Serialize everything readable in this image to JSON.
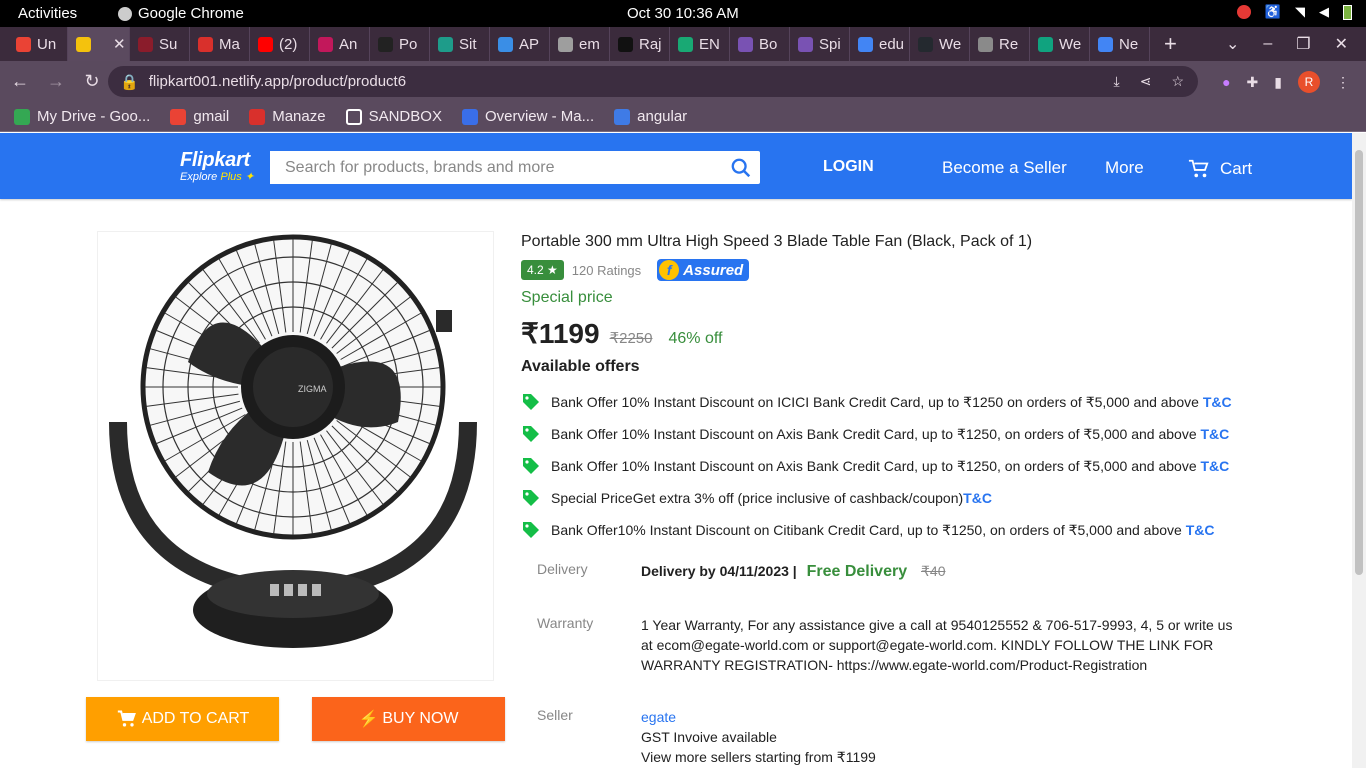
{
  "system": {
    "activities": "Activities",
    "app_name": "Google Chrome",
    "clock": "Oct 30  10:36 AM"
  },
  "tabs": [
    {
      "label": "Un",
      "color": "#ea4335"
    },
    {
      "label": "",
      "color": "#f4c20d"
    },
    {
      "label": "Su",
      "color": "#8a1c2b"
    },
    {
      "label": "Ma",
      "color": "#d9302c"
    },
    {
      "label": "(2)",
      "color": "#ff0000"
    },
    {
      "label": "An",
      "color": "#c2185b"
    },
    {
      "label": "Po",
      "color": "#222222"
    },
    {
      "label": "Sit",
      "color": "#1e9c8a"
    },
    {
      "label": "AP",
      "color": "#3a8ee6"
    },
    {
      "label": "em",
      "color": "#9e9e9e"
    },
    {
      "label": "Raj",
      "color": "#111111"
    },
    {
      "label": "EN",
      "color": "#19a974"
    },
    {
      "label": "Bo",
      "color": "#7952b3"
    },
    {
      "label": "Spi",
      "color": "#7952b3"
    },
    {
      "label": "edu",
      "color": "#4285f4"
    },
    {
      "label": "We",
      "color": "#24292f"
    },
    {
      "label": "Re",
      "color": "#8a8a8a"
    },
    {
      "label": "We",
      "color": "#10a37f"
    },
    {
      "label": "Ne",
      "color": "#4285f4"
    }
  ],
  "address": {
    "url": "flipkart001.netlify.app/product/product6"
  },
  "bookmarks": [
    {
      "label": "My Drive - Goo...",
      "color": "#34a853"
    },
    {
      "label": "gmail",
      "color": "#ea4335"
    },
    {
      "label": "Manaze",
      "color": "#d9302c"
    },
    {
      "label": "SANDBOX",
      "color": "#ffffff"
    },
    {
      "label": "Overview - Ma...",
      "color": "#3a6ee8"
    },
    {
      "label": "angular",
      "color": "#3f7be6"
    }
  ],
  "header": {
    "logo": "Flipkart",
    "logo_sub": "Explore",
    "logo_plus": "Plus",
    "search_placeholder": "Search for products, brands and more",
    "login": "LOGIN",
    "become_seller": "Become a Seller",
    "more": "More",
    "cart": "Cart",
    "brand_color": "#2874f0"
  },
  "product": {
    "title": "Portable 300 mm Ultra High Speed 3 Blade Table Fan (Black, Pack of 1)",
    "rating": "4.2 ★",
    "ratings_count": "120 Ratings",
    "assured": "Assured",
    "special": "Special price",
    "price": "₹1199",
    "mrp": "₹2250",
    "discount": "46% off",
    "available_offers": "Available offers",
    "offers": [
      {
        "text": "Bank Offer 10% Instant Discount on ICICI Bank Credit Card, up to ₹1250 on orders of ₹5,000 and above ",
        "tc": "T&C"
      },
      {
        "text": "Bank Offer 10% Instant Discount on Axis Bank Credit Card, up to ₹1250, on orders of ₹5,000 and above ",
        "tc": "T&C"
      },
      {
        "text": "Bank Offer 10% Instant Discount on Axis Bank Credit Card, up to ₹1250, on orders of ₹5,000 and above ",
        "tc": "T&C"
      },
      {
        "text": "Special PriceGet extra 3% off (price inclusive of cashback/coupon)",
        "tc": "T&C"
      },
      {
        "text": "Bank Offer10% Instant Discount on Citibank Credit Card, up to ₹1250, on orders of ₹5,000 and above ",
        "tc": "T&C"
      }
    ],
    "delivery_label": "Delivery",
    "delivery_text": "Delivery by 04/11/2023 |",
    "free_delivery": "Free Delivery",
    "delivery_charge": "₹40",
    "warranty_label": "Warranty",
    "warranty_text": "1 Year Warranty, For any assistance give a call at 9540125552 & 706-517-9993, 4, 5 or write us at ecom@egate-world.com or support@egate-world.com. KINDLY FOLLOW THE LINK FOR WARRANTY REGISTRATION- https://www.egate-world.com/Product-Registration",
    "seller_label": "Seller",
    "seller_name": "egate",
    "gst": "GST Invoive available",
    "more_sellers": "View more sellers starting from ₹1199"
  },
  "buttons": {
    "add_to_cart": "ADD TO CART",
    "buy_now": "BUY NOW",
    "add_color": "#ff9f00",
    "buy_color": "#fb641b"
  }
}
